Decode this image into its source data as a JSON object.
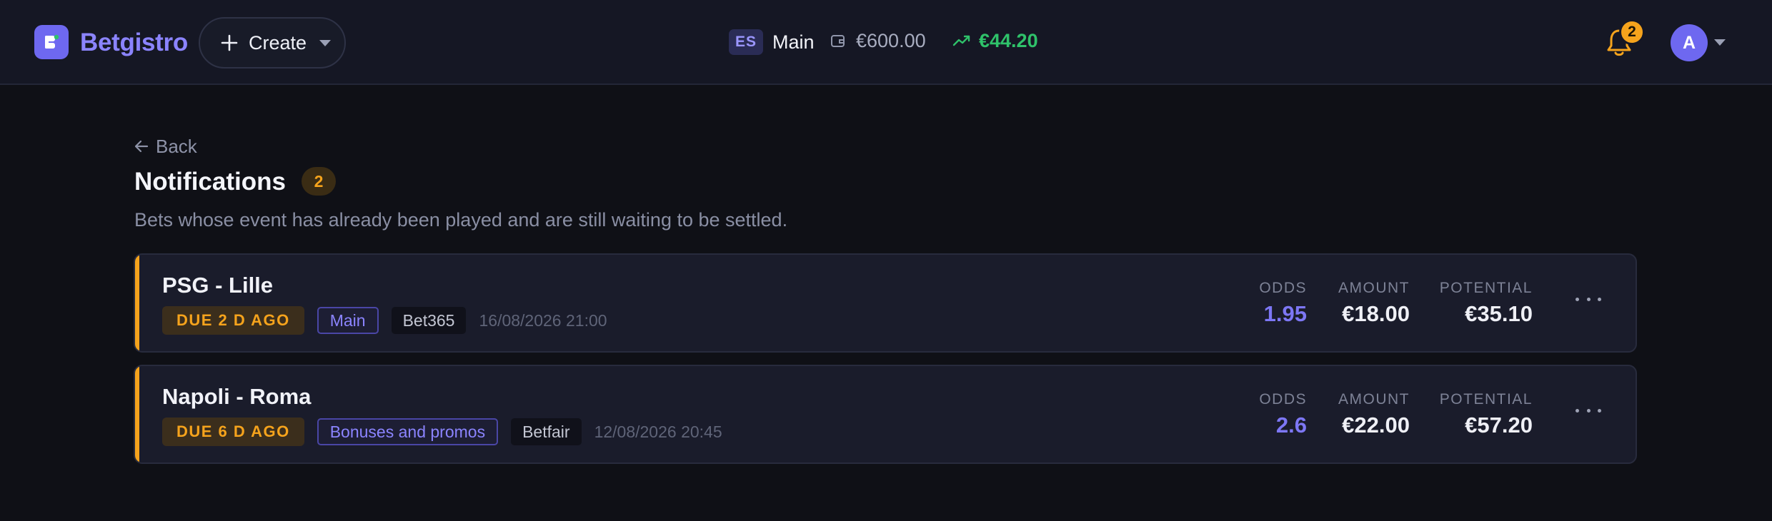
{
  "header": {
    "brand": "Betgistro",
    "create_label": "Create",
    "account_code": "ES",
    "account_name": "Main",
    "balance": "€600.00",
    "profit": "€44.20",
    "notification_count": "2",
    "avatar_initial": "A"
  },
  "page": {
    "back_label": "Back",
    "title": "Notifications",
    "count": "2",
    "subtitle": "Bets whose event has already been played and are still waiting to be settled."
  },
  "labels": {
    "odds": "ODDS",
    "amount": "AMOUNT",
    "potential": "POTENTIAL"
  },
  "bets": [
    {
      "event": "PSG - Lille",
      "due": "DUE 2 D AGO",
      "account": "Main",
      "bookmaker": "Bet365",
      "datetime": "16/08/2026 21:00",
      "odds": "1.95",
      "amount": "€18.00",
      "potential": "€35.10"
    },
    {
      "event": "Napoli - Roma",
      "due": "DUE 6 D AGO",
      "account": "Bonuses and promos",
      "bookmaker": "Betfair",
      "datetime": "12/08/2026 20:45",
      "odds": "2.6",
      "amount": "€22.00",
      "potential": "€57.20"
    }
  ],
  "colors": {
    "accent": "#6e68f0",
    "warning": "#f5a31c",
    "positive": "#2fc26a",
    "background": "#0f1016"
  }
}
